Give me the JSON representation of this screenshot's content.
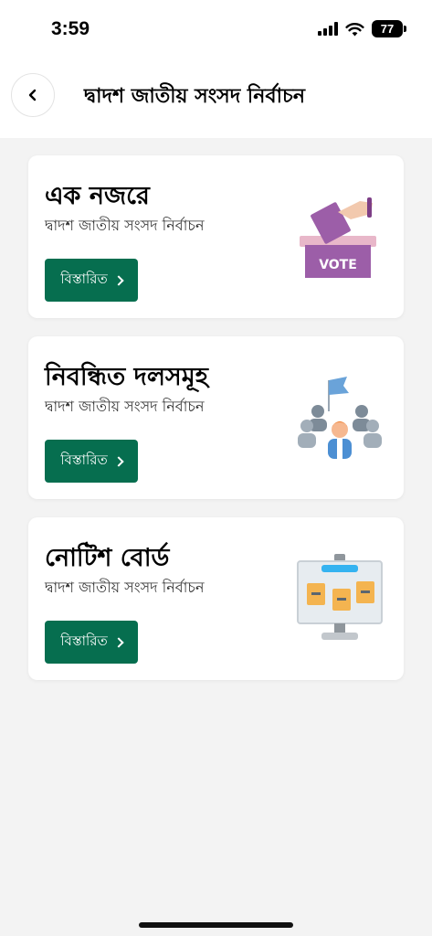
{
  "status_bar": {
    "time": "3:59",
    "battery": "77"
  },
  "header": {
    "title": "দ্বাদশ জাতীয় সংসদ নির্বাচন"
  },
  "cards": [
    {
      "title": "এক নজরে",
      "subtitle": "দ্বাদশ জাতীয় সংসদ নির্বাচন",
      "button_label": "বিস্তারিত",
      "illustration": "vote-box-icon",
      "illustration_text": "VOTE"
    },
    {
      "title": "নিবন্ধিত দলসমূহ",
      "subtitle": "দ্বাদশ জাতীয় সংসদ নির্বাচন",
      "button_label": "বিস্তারিত",
      "illustration": "people-group-icon"
    },
    {
      "title": "নোটিশ বোর্ড",
      "subtitle": "দ্বাদশ জাতীয় সংসদ নির্বাচন",
      "button_label": "বিস্তারিত",
      "illustration": "notice-board-icon"
    }
  ],
  "colors": {
    "accent": "#066e4f",
    "background": "#f3f3f3",
    "card": "#ffffff"
  }
}
